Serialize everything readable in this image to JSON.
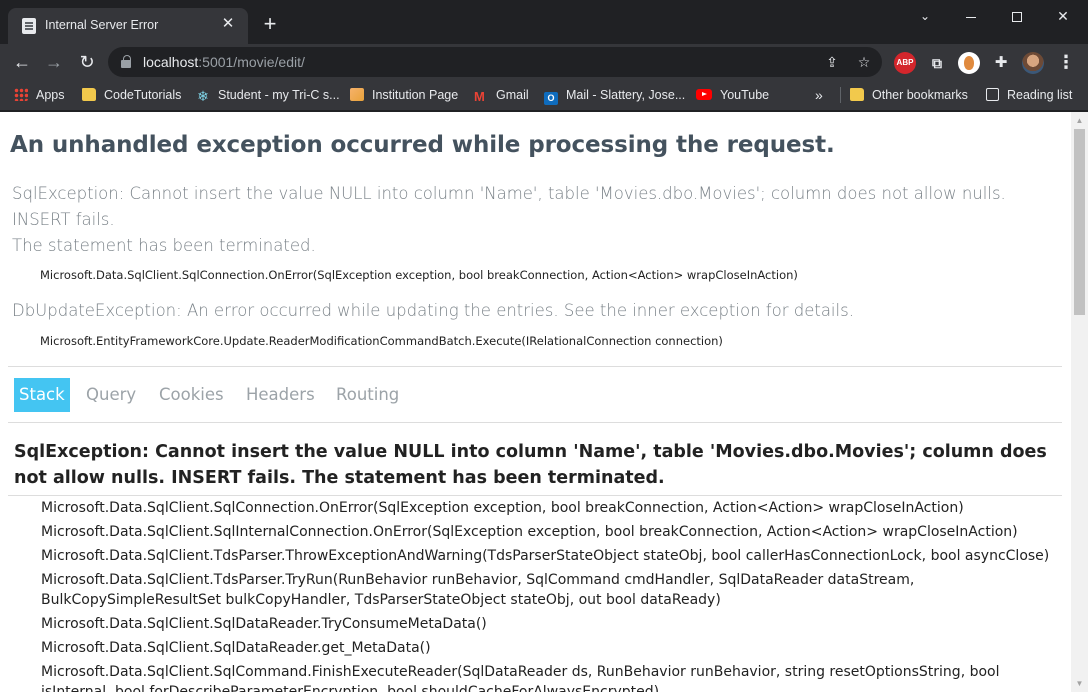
{
  "browser": {
    "tab_title": "Internal Server Error",
    "tab_close": "✕",
    "new_tab": "+",
    "url_host": "localhost",
    "url_rest": ":5001/movie/edit/",
    "ext_abp": "ABP",
    "bookmarks": [
      {
        "label": "Apps",
        "icon": "apps-grid-icon"
      },
      {
        "label": "CodeTutorials",
        "icon": "folder-icon"
      },
      {
        "label": "Student - my Tri-C s...",
        "icon": "snowflake-icon"
      },
      {
        "label": "Institution Page",
        "icon": "institution-icon"
      },
      {
        "label": "Gmail",
        "icon": "gmail-icon"
      },
      {
        "label": "Mail - Slattery, Jose...",
        "icon": "outlook-icon"
      },
      {
        "label": "YouTube",
        "icon": "youtube-icon"
      }
    ],
    "bookmarks_more": "»",
    "other_bookmarks": "Other bookmarks",
    "reading_list": "Reading list",
    "colors": {
      "tabstrip": "#202124",
      "toolbar": "#35363a",
      "abp": "#d4262c"
    }
  },
  "page": {
    "heading": "An unhandled exception occurred while processing the request.",
    "errors": [
      {
        "title_line1": "SqlException: Cannot insert the value NULL into column 'Name', table 'Movies.dbo.Movies'; column does not allow nulls. INSERT fails.",
        "title_line2": "The statement has been terminated.",
        "location": "Microsoft.Data.SqlClient.SqlConnection.OnError(SqlException exception, bool breakConnection, Action<Action> wrapCloseInAction)"
      },
      {
        "title_line1": "DbUpdateException: An error occurred while updating the entries. See the inner exception for details.",
        "location": "Microsoft.EntityFrameworkCore.Update.ReaderModificationCommandBatch.Execute(IRelationalConnection connection)"
      }
    ],
    "tabs": [
      "Stack",
      "Query",
      "Cookies",
      "Headers",
      "Routing"
    ],
    "active_tab": "Stack",
    "stack_title": "SqlException: Cannot insert the value NULL into column 'Name', table 'Movies.dbo.Movies'; column does not allow nulls. INSERT fails. The statement has been terminated.",
    "frames": [
      "Microsoft.Data.SqlClient.SqlConnection.OnError(SqlException exception, bool breakConnection, Action<Action> wrapCloseInAction)",
      "Microsoft.Data.SqlClient.SqlInternalConnection.OnError(SqlException exception, bool breakConnection, Action<Action> wrapCloseInAction)",
      "Microsoft.Data.SqlClient.TdsParser.ThrowExceptionAndWarning(TdsParserStateObject stateObj, bool callerHasConnectionLock, bool asyncClose)",
      "Microsoft.Data.SqlClient.TdsParser.TryRun(RunBehavior runBehavior, SqlCommand cmdHandler, SqlDataReader dataStream, BulkCopySimpleResultSet bulkCopyHandler, TdsParserStateObject stateObj, out bool dataReady)",
      "Microsoft.Data.SqlClient.SqlDataReader.TryConsumeMetaData()",
      "Microsoft.Data.SqlClient.SqlDataReader.get_MetaData()",
      "Microsoft.Data.SqlClient.SqlCommand.FinishExecuteReader(SqlDataReader ds, RunBehavior runBehavior, string resetOptionsString, bool isInternal, bool forDescribeParameterEncryption, bool shouldCacheForAlwaysEncrypted)"
    ],
    "colors": {
      "heading": "#44525e",
      "active_tab": "#44c5f2",
      "muted": "#7a8288"
    }
  }
}
